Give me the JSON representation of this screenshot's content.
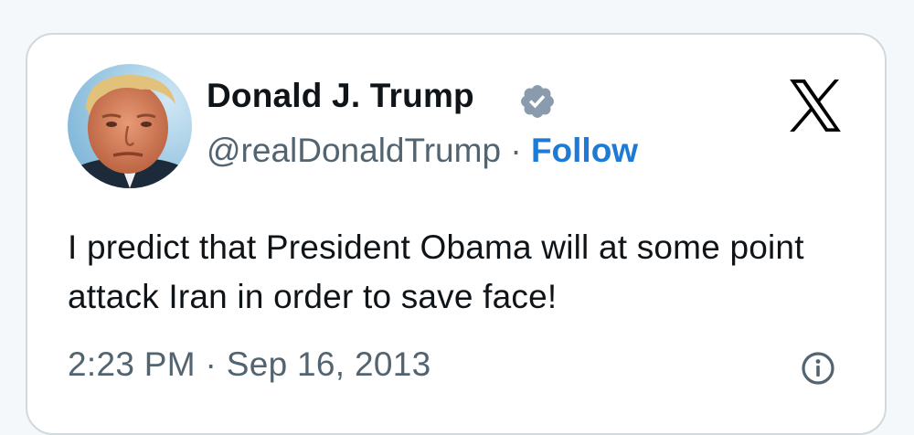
{
  "tweet": {
    "author": {
      "display_name": "Donald J. Trump",
      "handle": "@realDonaldTrump",
      "verified": true,
      "avatar_icon": "profile-photo"
    },
    "separator": "·",
    "follow_label": "Follow",
    "text": "I predict that President Obama will at some point attack Iran in order to save face!",
    "time": "2:23 PM",
    "date": "Sep 16, 2013",
    "platform_icon": "x-logo-icon",
    "info_icon": "info-icon"
  },
  "colors": {
    "text_primary": "#0f1419",
    "text_secondary": "#536471",
    "follow": "#1d7bd6",
    "verified_badge": "#8a9bad",
    "border": "#cfd9de"
  }
}
